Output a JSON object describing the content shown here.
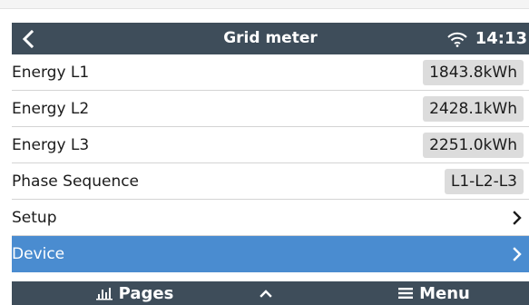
{
  "header": {
    "title": "Grid meter",
    "clock": "14:13",
    "back_icon": "chevron-left-icon",
    "wifi_icon": "wifi-icon"
  },
  "rows": [
    {
      "label": "Energy L1",
      "value": "1843.8kWh"
    },
    {
      "label": "Energy L2",
      "value": "2428.1kWh"
    },
    {
      "label": "Energy L3",
      "value": "2251.0kWh"
    },
    {
      "label": "Phase Sequence",
      "value": "L1-L2-L3"
    },
    {
      "label": "Setup"
    },
    {
      "label": "Device"
    }
  ],
  "footer": {
    "pages_label": "Pages",
    "menu_label": "Menu",
    "pages_icon": "bar-chart-icon",
    "up_icon": "chevron-up-icon",
    "menu_icon": "hamburger-icon"
  },
  "colors": {
    "bar_background": "#3e4d5a",
    "selected_row": "#4a8cd0",
    "value_box": "#dcdcdc",
    "divider": "#d4d4d4"
  }
}
